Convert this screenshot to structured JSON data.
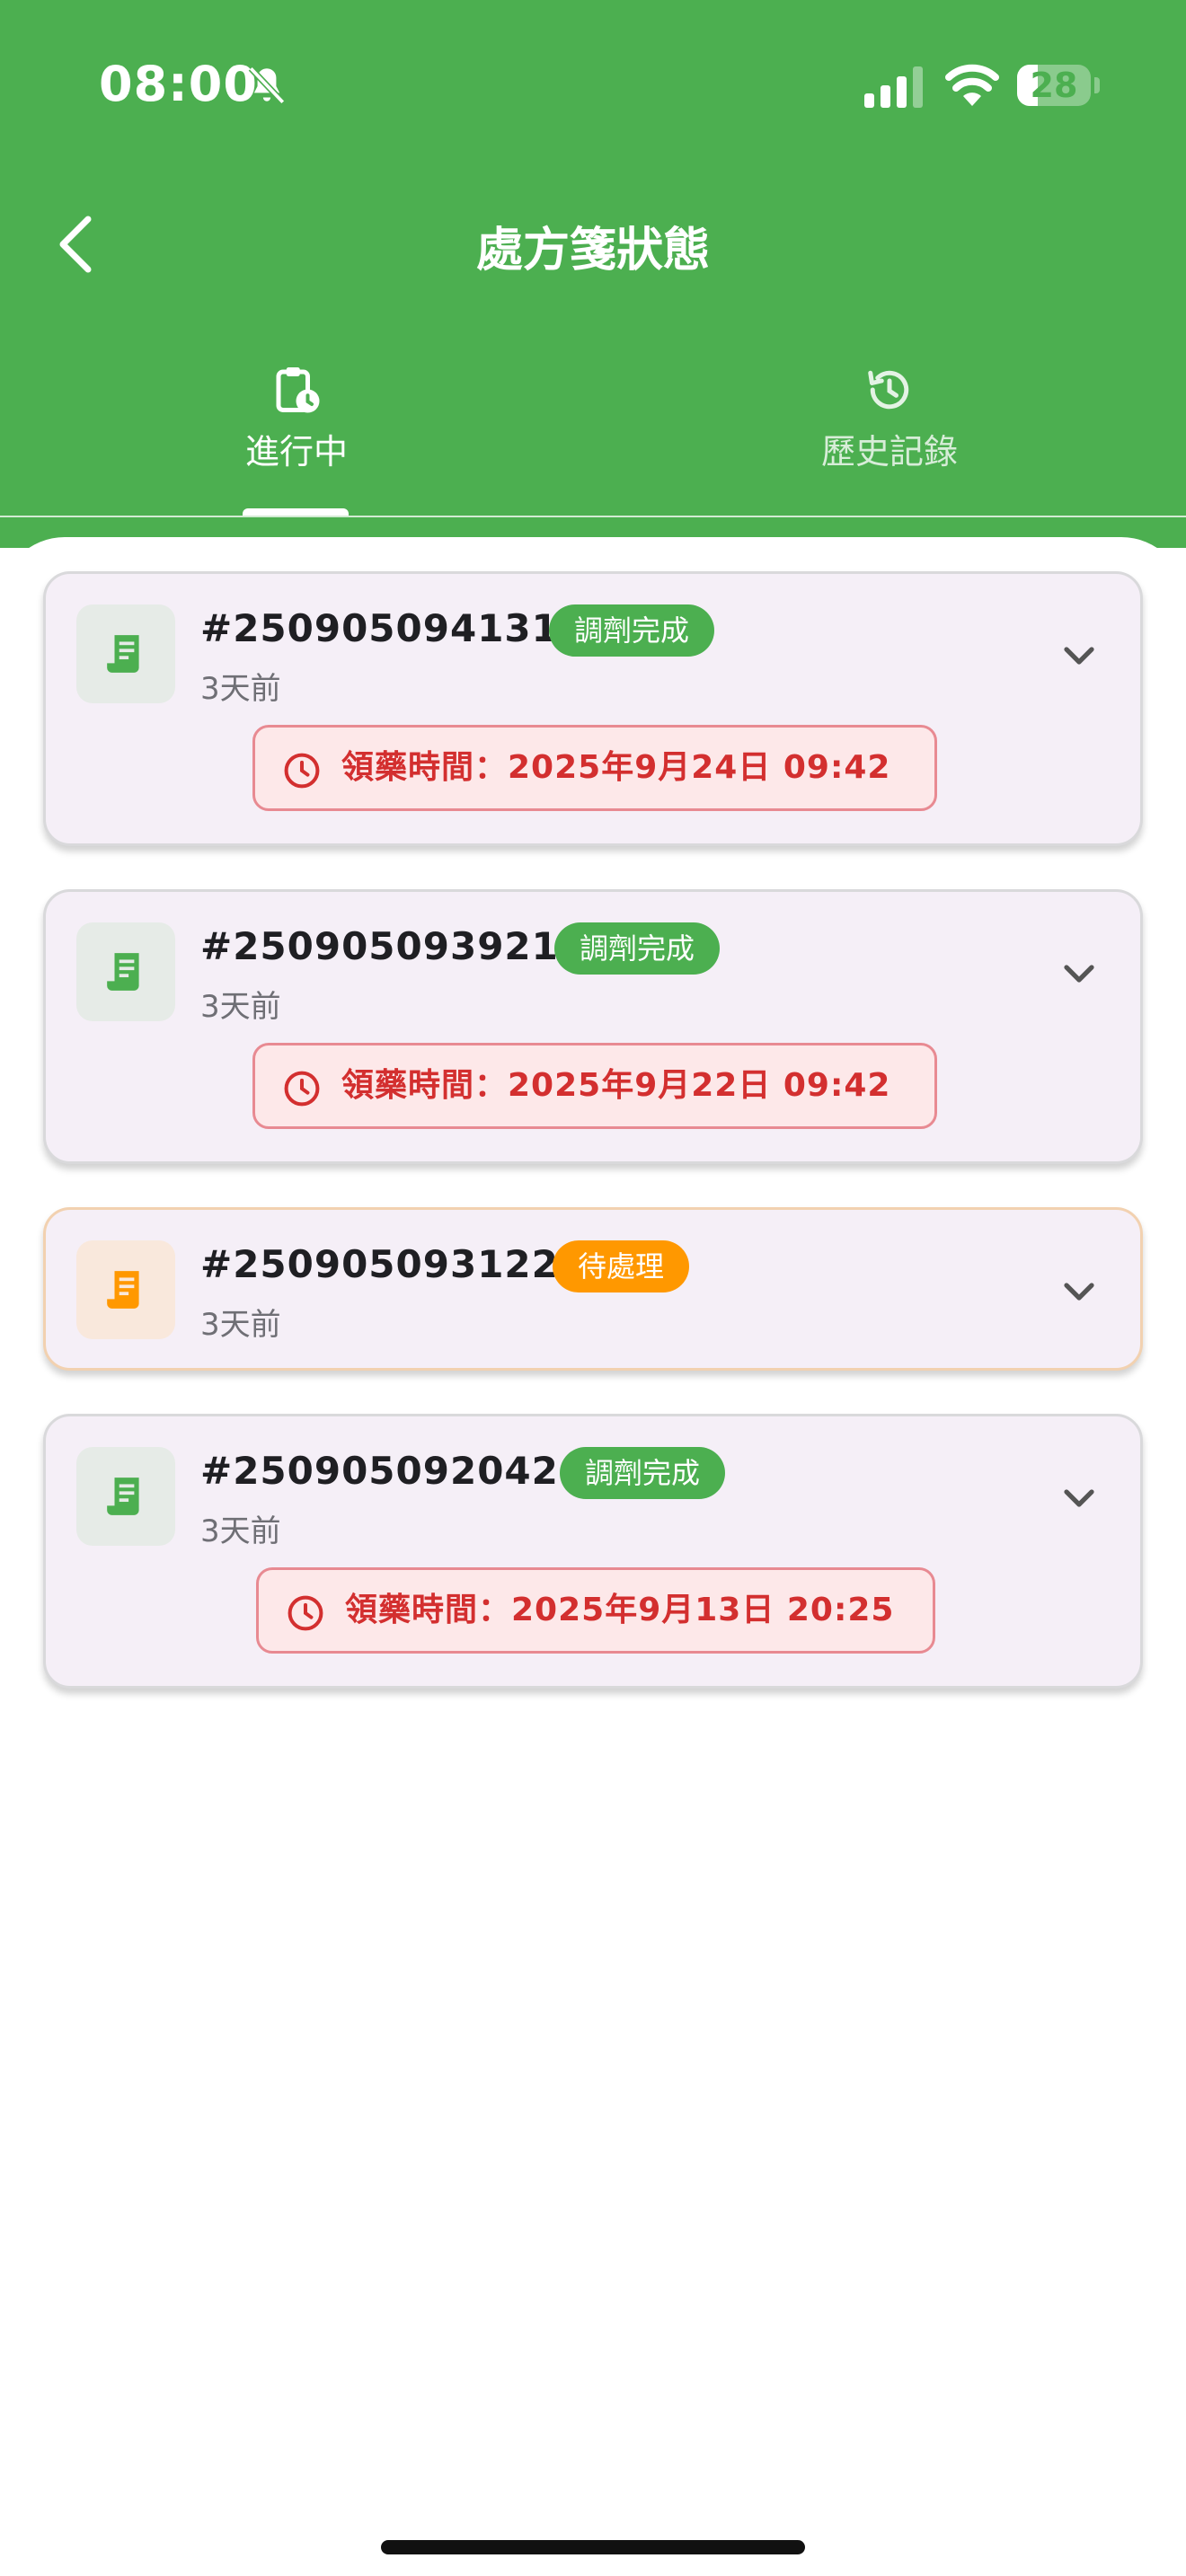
{
  "status_bar": {
    "time": "08:00",
    "battery": "28",
    "battery_level": 0.28
  },
  "header": {
    "title": "處方箋狀態"
  },
  "tabs": [
    {
      "label": "進行中",
      "icon": "clipboard-clock-icon",
      "active": true
    },
    {
      "label": "歷史記錄",
      "icon": "history-icon",
      "active": false
    }
  ],
  "colors": {
    "primary": "#4caf50",
    "pending": "#ff9800",
    "alert_text": "#d32f2f",
    "card_bg": "#f5eff7"
  },
  "prescriptions": [
    {
      "id": "#250905094131",
      "status": "調劑完成",
      "status_type": "done",
      "time_ago": "3天前",
      "pickup_time": "領藥時間：2025年9月24日 09:42"
    },
    {
      "id": "#250905093921",
      "status": "調劑完成",
      "status_type": "done",
      "time_ago": "3天前",
      "pickup_time": "領藥時間：2025年9月22日 09:42"
    },
    {
      "id": "#250905093122",
      "status": "待處理",
      "status_type": "waiting",
      "time_ago": "3天前",
      "pickup_time": ""
    },
    {
      "id": "#250905092042",
      "status": "調劑完成",
      "status_type": "done",
      "time_ago": "3天前",
      "pickup_time": "領藥時間：2025年9月13日 20:25"
    }
  ]
}
